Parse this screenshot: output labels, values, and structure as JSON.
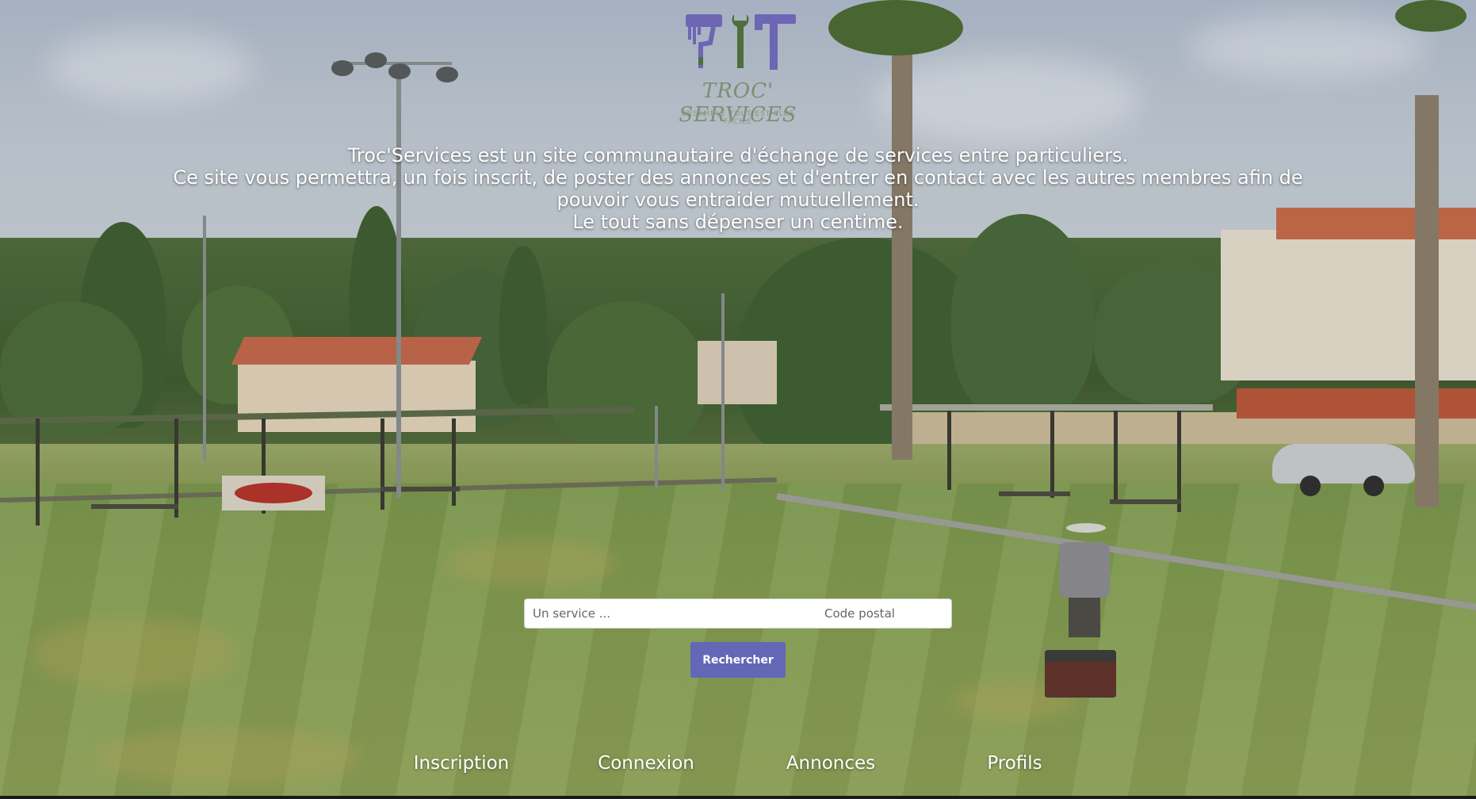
{
  "brand": {
    "name": "TROC' SERVICES",
    "tagline": "ENSEMBLE TOUT EST PLUS FACILE",
    "logo_icon": "paint-roller-wrench-hammer-logo",
    "accent_color": "#6466b6",
    "logo_green": "#7b8f72"
  },
  "intro": {
    "line1": "Troc'Services est un site communautaire d'échange de services entre particuliers.",
    "line2": "Ce site vous permettra, un fois inscrit, de poster des annonces et d'entrer en contact avec les autres membres afin de pouvoir vous entraider mutuellement.",
    "line3": "Le tout sans dépenser un centime."
  },
  "search": {
    "service_placeholder": "Un service ...",
    "service_value": "",
    "postal_placeholder": "Code postal",
    "postal_value": "",
    "button_label": "Rechercher"
  },
  "nav": {
    "items": [
      {
        "label": "Inscription"
      },
      {
        "label": "Connexion"
      },
      {
        "label": "Annonces"
      },
      {
        "label": "Profils"
      }
    ]
  }
}
